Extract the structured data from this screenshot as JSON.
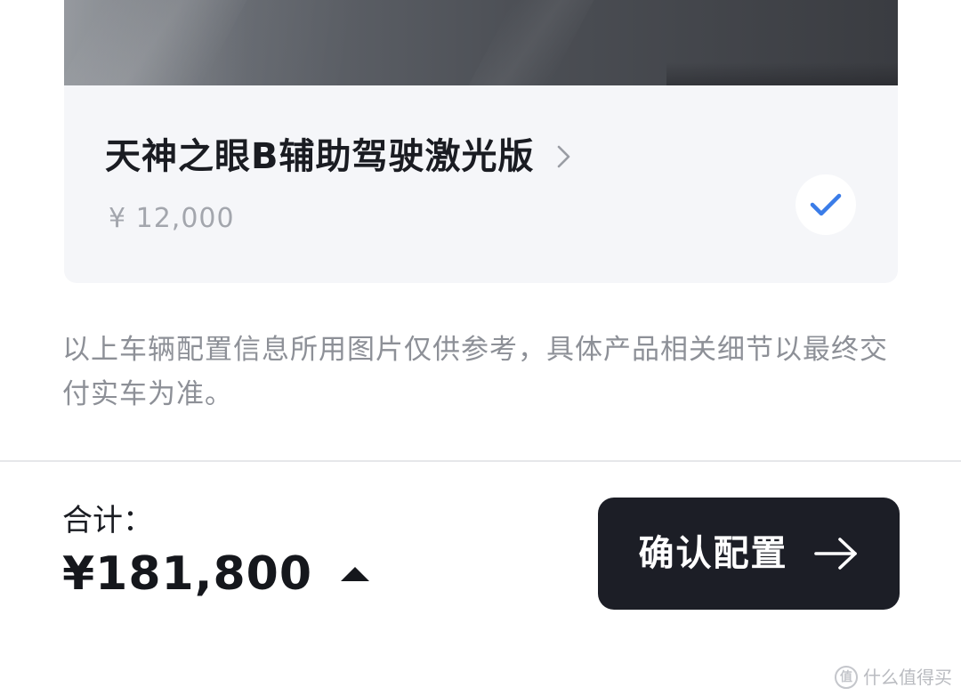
{
  "option": {
    "title": "天神之眼B辅助驾驶激光版",
    "price": "¥ 12,000",
    "selected": true,
    "check_color": "#3a7ce8"
  },
  "disclaimer": "以上车辆配置信息所用图片仅供参考，具体产品相关细节以最终交付实车为准。",
  "footer": {
    "total_label": "合计：",
    "total_amount": "¥181,800",
    "confirm_label": "确认配置"
  },
  "watermark": {
    "text": "什么值得买",
    "logo_glyph": "值"
  },
  "colors": {
    "button_bg": "#1c1e26",
    "card_bg": "#f5f6f9",
    "muted_text": "#8d9097"
  }
}
